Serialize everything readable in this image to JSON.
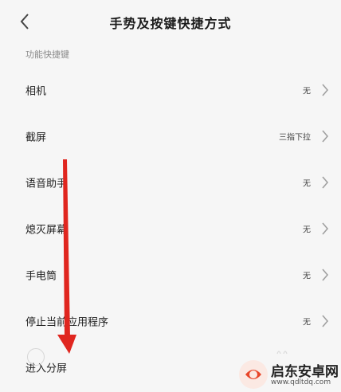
{
  "header": {
    "title": "手势及按键快捷方式",
    "back_icon": "chevron-left-icon"
  },
  "section": {
    "label": "功能快捷键"
  },
  "items": [
    {
      "label": "相机",
      "value": "无"
    },
    {
      "label": "截屏",
      "value": "三指下拉"
    },
    {
      "label": "语音助手",
      "value": "无"
    },
    {
      "label": "熄灭屏幕",
      "value": "无"
    },
    {
      "label": "手电筒",
      "value": "无"
    },
    {
      "label": "停止当前应用程序",
      "value": "无"
    },
    {
      "label": "进入分屏",
      "value": ""
    }
  ],
  "overlay": {
    "arrow_color": "#e0261f",
    "arrow_icon": "red-down-arrow-annotation"
  },
  "watermark": {
    "title": "启东安卓网",
    "url": "www.qdltdq.com",
    "accent": "#e8462a"
  }
}
